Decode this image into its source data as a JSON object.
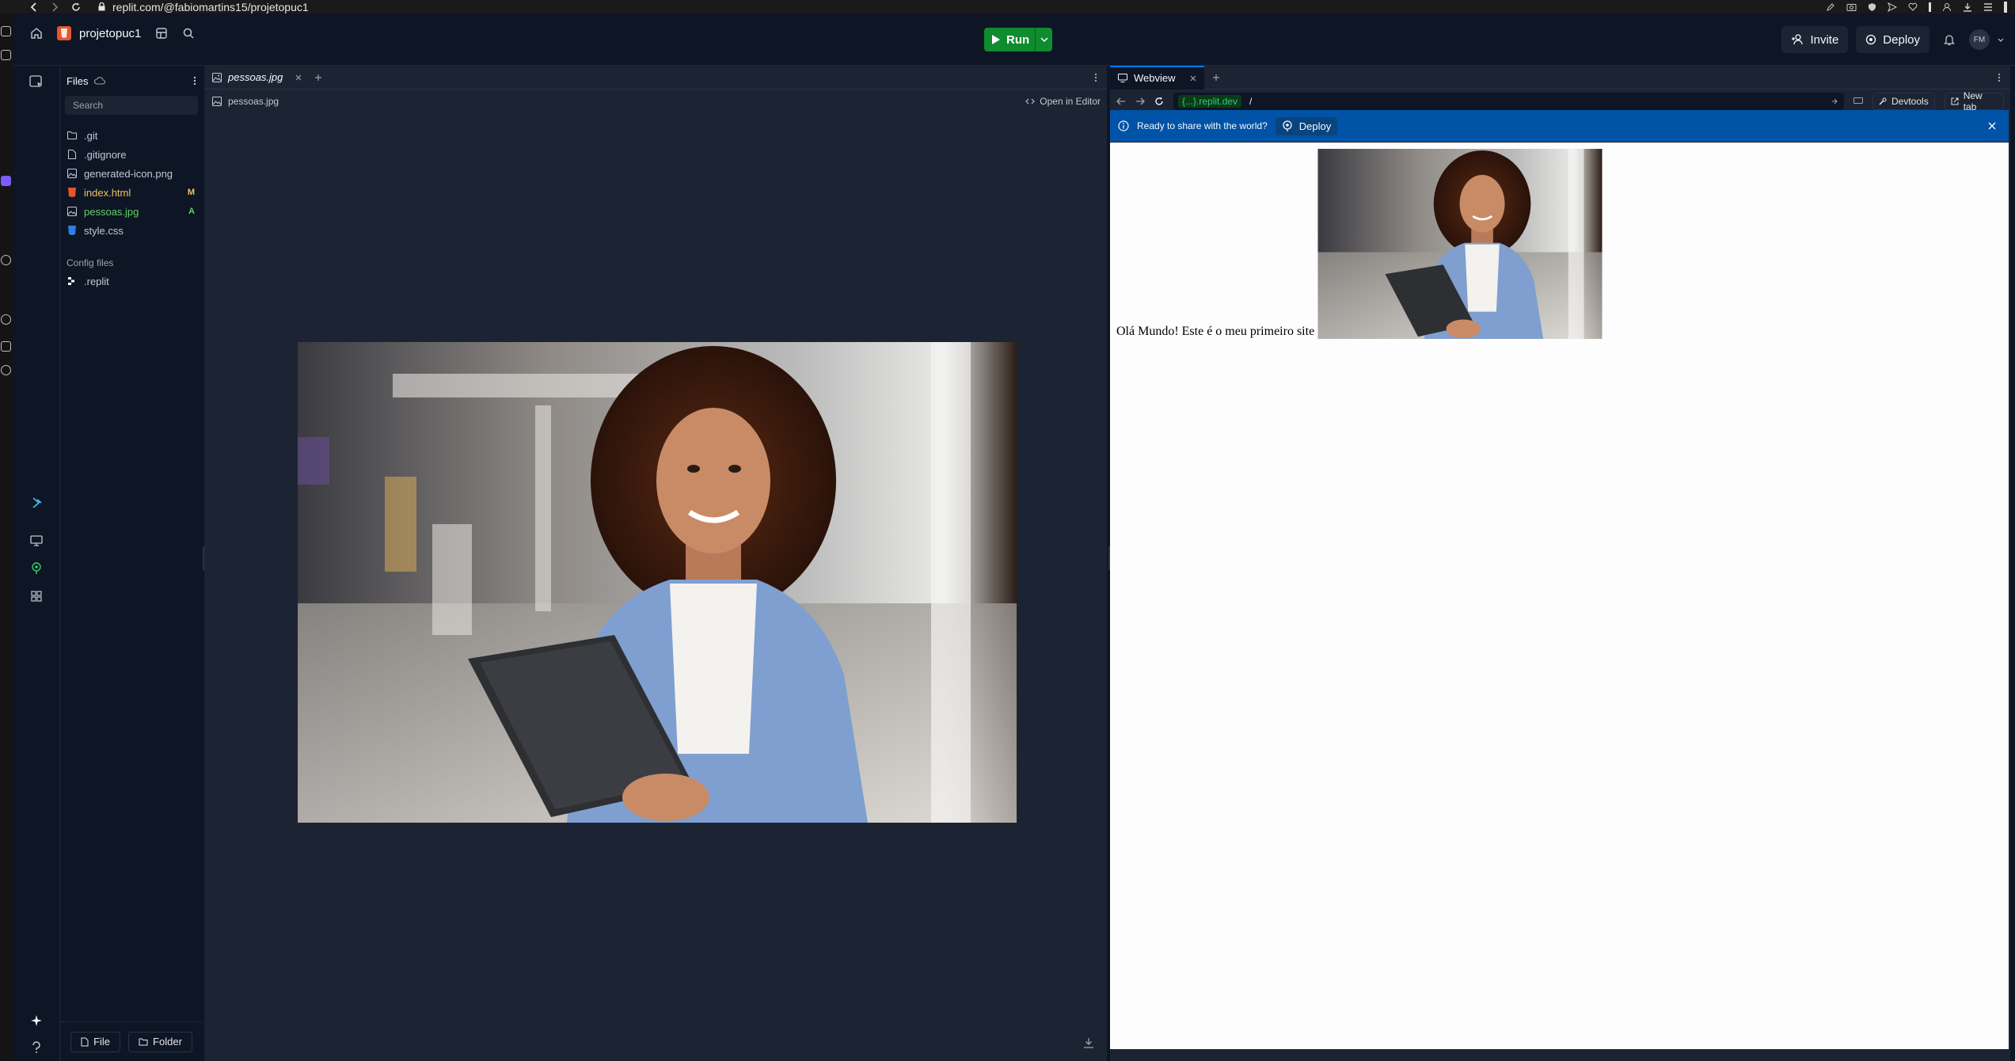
{
  "browser": {
    "url": "replit.com/@fabiomartins15/projetopuc1"
  },
  "header": {
    "project_name": "projetopuc1",
    "run_label": "Run",
    "invite_label": "Invite",
    "deploy_label": "Deploy",
    "avatar_initials": "FM"
  },
  "files": {
    "title": "Files",
    "search_placeholder": "Search",
    "items": [
      {
        "name": ".git",
        "type": "folder",
        "color": "#c2c8d4",
        "badge": ""
      },
      {
        "name": ".gitignore",
        "type": "file",
        "color": "#c2c8d4",
        "badge": ""
      },
      {
        "name": "generated-icon.png",
        "type": "image",
        "color": "#c2c8d4",
        "badge": ""
      },
      {
        "name": "index.html",
        "type": "html",
        "color": "#f0c35a",
        "badge": "M"
      },
      {
        "name": "pessoas.jpg",
        "type": "image",
        "color": "#5fd35f",
        "badge": "A"
      },
      {
        "name": "style.css",
        "type": "css",
        "color": "#c2c8d4",
        "badge": ""
      }
    ],
    "config_label": "Config files",
    "config_items": [
      {
        "name": ".replit"
      }
    ],
    "new_file_label": "File",
    "new_folder_label": "Folder"
  },
  "editor": {
    "tab_label": "pessoas.jpg",
    "breadcrumb": "pessoas.jpg",
    "open_in_editor": "Open in Editor"
  },
  "webview": {
    "tab_label": "Webview",
    "domain": "{...}.replit.dev",
    "path": "/",
    "devtools_label": "Devtools",
    "new_tab_label": "New tab",
    "banner_text": "Ready to share with the world?",
    "banner_deploy": "Deploy",
    "site_text": "Olá Mundo! Este é o meu primeiro site"
  },
  "colors": {
    "bg": "#0e1525",
    "panel": "#1c2333",
    "run_green": "#0f8c2e",
    "banner_blue": "#0053a6"
  }
}
